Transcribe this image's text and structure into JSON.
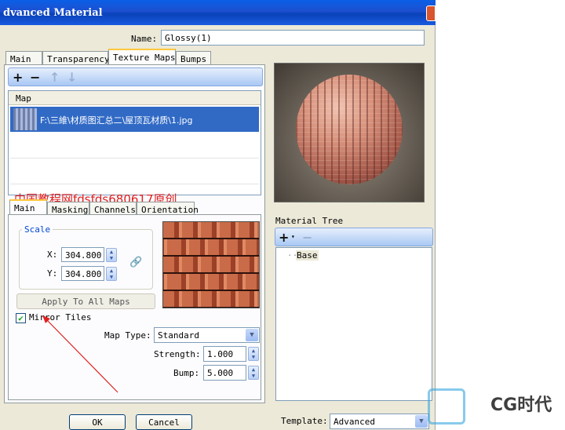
{
  "window": {
    "title": "dvanced Material"
  },
  "name_field": {
    "label": "Name:",
    "value": "Glossy(1)"
  },
  "main_tabs": [
    "Main",
    "Transparency",
    "Texture Maps",
    "Bumps"
  ],
  "maps_list": {
    "column_header": "Map",
    "row_path": "F:\\三維\\材质图汇总二\\屋顶瓦材质\\1.jpg"
  },
  "overlay_text": "中国教程网fdsfds680617原创",
  "sub_tabs": [
    "Main",
    "Masking",
    "Channels",
    "Orientation"
  ],
  "scale": {
    "legend": "Scale",
    "x_label": "X:",
    "x_value": "304.800",
    "y_label": "Y:",
    "y_value": "304.800"
  },
  "apply_button": "Apply To All Maps",
  "mirror_tiles": {
    "label": "Mirror Tiles",
    "checked": true
  },
  "map_type": {
    "label": "Map Type:",
    "value": "Standard"
  },
  "strength": {
    "label": "Strength:",
    "value": "1.000"
  },
  "bump": {
    "label": "Bump:",
    "value": "5.000"
  },
  "material_tree": {
    "title": "Material Tree",
    "item": "Base"
  },
  "template": {
    "label": "Template:",
    "value": "Advanced"
  },
  "buttons": {
    "ok": "OK",
    "cancel": "Cancel"
  },
  "watermark_logo": {
    "text": "CG时代"
  },
  "colors": {
    "title_bar": "#0a5fe6",
    "selection": "#316ac5",
    "accent_tab": "#ffc83c",
    "annotation_red": "#e02020"
  },
  "icons": [
    "add-icon",
    "remove-icon",
    "arrow-up-icon",
    "arrow-down-icon",
    "link-icon",
    "close-icon",
    "checkmark-icon",
    "chevron-down-icon"
  ]
}
